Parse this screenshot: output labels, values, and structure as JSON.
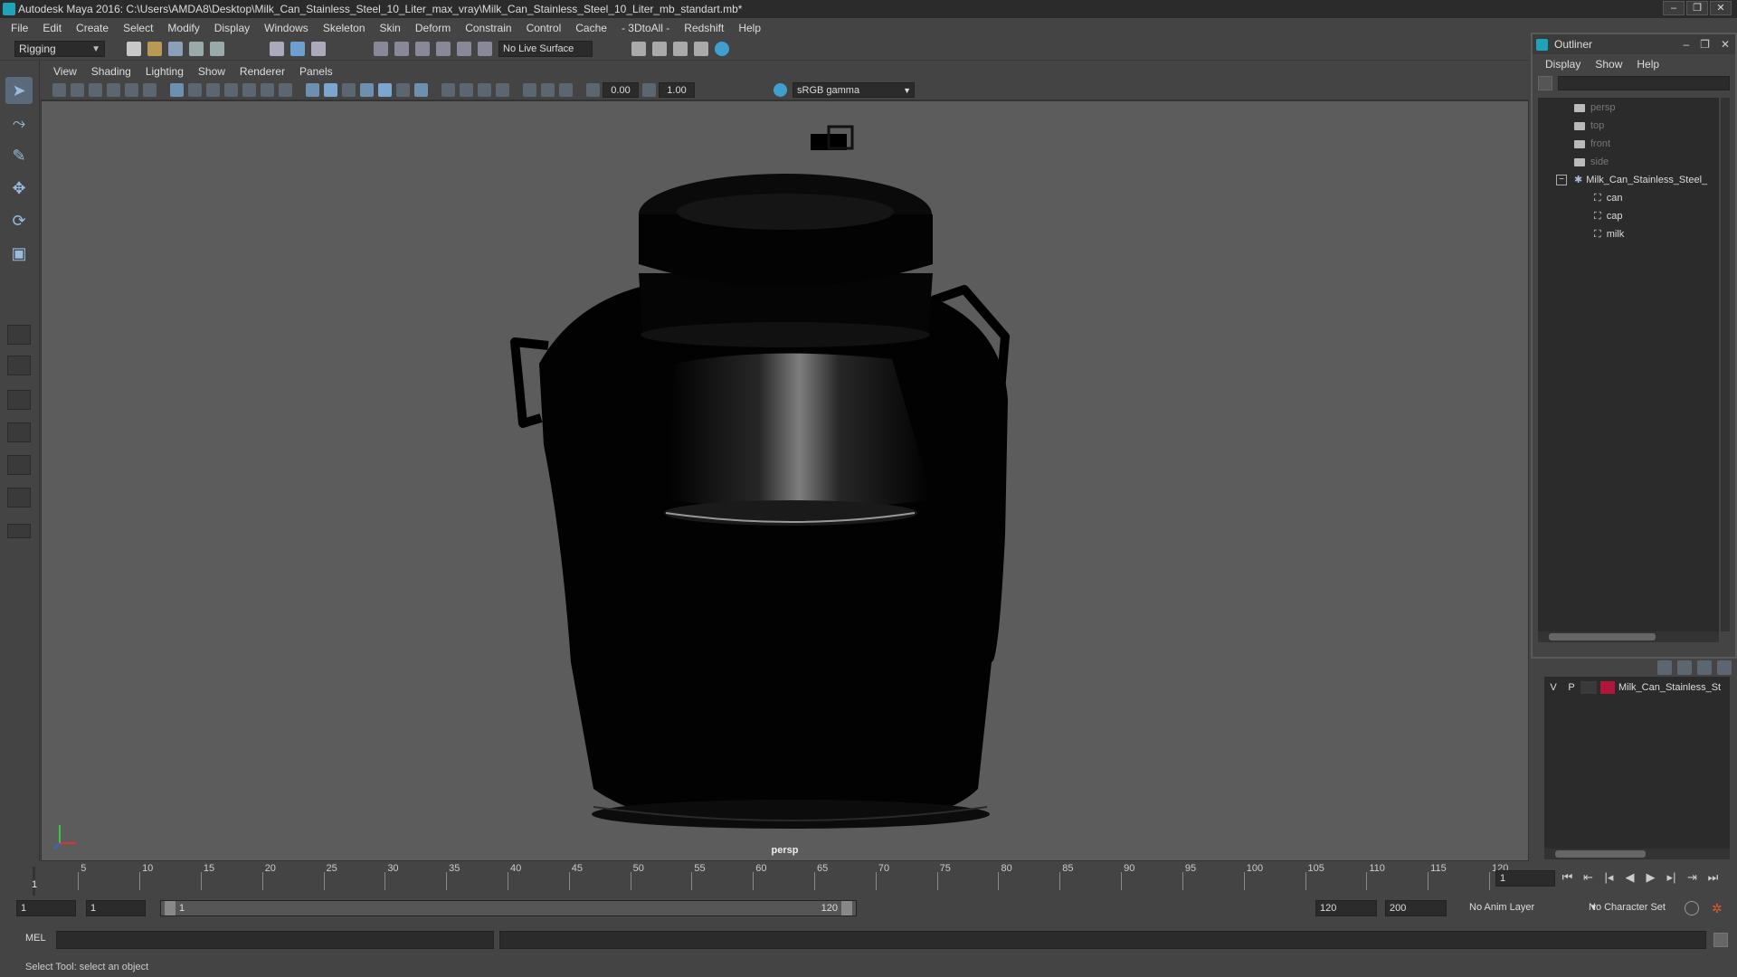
{
  "window": {
    "title": "Autodesk Maya 2016: C:\\Users\\AMDA8\\Desktop\\Milk_Can_Stainless_Steel_10_Liter_max_vray\\Milk_Can_Stainless_Steel_10_Liter_mb_standart.mb*",
    "buttons": [
      "–",
      "❐",
      "✕"
    ]
  },
  "menubar": [
    "File",
    "Edit",
    "Create",
    "Select",
    "Modify",
    "Display",
    "Windows",
    "Skeleton",
    "Skin",
    "Deform",
    "Constrain",
    "Control",
    "Cache",
    "- 3DtoAll -",
    "Redshift",
    "Help"
  ],
  "shelf": {
    "mode": "Rigging",
    "live_surface": "No Live Surface"
  },
  "viewport": {
    "menu": [
      "View",
      "Shading",
      "Lighting",
      "Show",
      "Renderer",
      "Panels"
    ],
    "exposure": "0.00",
    "gamma": "1.00",
    "color_space": "sRGB gamma",
    "camera": "persp"
  },
  "outliner": {
    "title": "Outliner",
    "menu": [
      "Display",
      "Show",
      "Help"
    ],
    "items": [
      {
        "label": "persp",
        "kind": "camera"
      },
      {
        "label": "top",
        "kind": "camera"
      },
      {
        "label": "front",
        "kind": "camera"
      },
      {
        "label": "side",
        "kind": "camera"
      },
      {
        "label": "Milk_Can_Stainless_Steel_",
        "kind": "group"
      },
      {
        "label": "can",
        "kind": "mesh"
      },
      {
        "label": "cap",
        "kind": "mesh"
      },
      {
        "label": "milk",
        "kind": "mesh"
      }
    ]
  },
  "layers": {
    "rows": [
      {
        "v": "V",
        "p": "P",
        "name": "Milk_Can_Stainless_St",
        "color": "#b0163a"
      }
    ]
  },
  "timeline": {
    "ticks": [
      "5",
      "10",
      "15",
      "20",
      "25",
      "30",
      "35",
      "40",
      "45",
      "50",
      "55",
      "60",
      "65",
      "70",
      "75",
      "80",
      "85",
      "90",
      "95",
      "100",
      "105",
      "110",
      "115",
      "120"
    ],
    "current_marker": "1",
    "current_frame": "1"
  },
  "range": {
    "start": "1",
    "playback_start": "1",
    "slider_start": "1",
    "slider_end": "120",
    "playback_end": "120",
    "end": "200",
    "anim_layer": "No Anim Layer",
    "character_set": "No Character Set"
  },
  "command": {
    "label": "MEL"
  },
  "help_line": "Select Tool: select an object",
  "colors": {
    "accent": "#1fa3b8",
    "layer": "#b0163a",
    "background": "#444444"
  }
}
